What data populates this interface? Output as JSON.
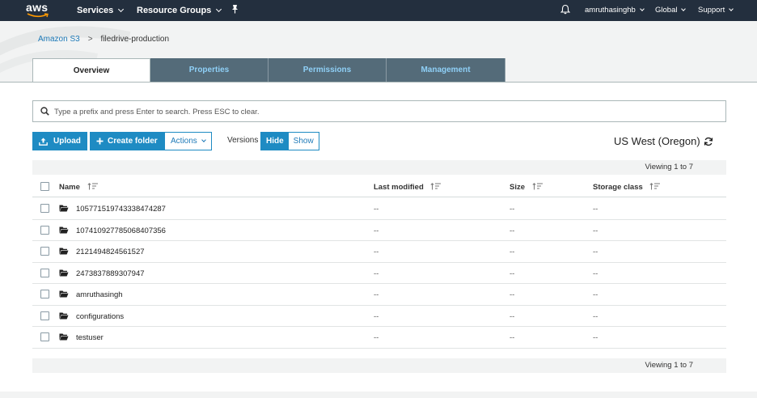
{
  "nav": {
    "logo": "aws",
    "services": "Services",
    "resource_groups": "Resource Groups",
    "pin_icon": "pushpin-icon",
    "bell_icon": "bell-icon",
    "user": "amruthasinghb",
    "region": "Global",
    "support": "Support"
  },
  "breadcrumb": {
    "root": "Amazon S3",
    "separator": ">",
    "current": "filedrive-production"
  },
  "tabs": [
    {
      "label": "Overview",
      "active": true
    },
    {
      "label": "Properties",
      "active": false
    },
    {
      "label": "Permissions",
      "active": false
    },
    {
      "label": "Management",
      "active": false
    }
  ],
  "search": {
    "placeholder": "Type a prefix and press Enter to search. Press ESC to clear.",
    "value": ""
  },
  "toolbar": {
    "upload": "Upload",
    "create_folder": "Create folder",
    "actions": "Actions",
    "versions_label": "Versions",
    "hide": "Hide",
    "show": "Show",
    "region": "US West (Oregon)"
  },
  "table": {
    "viewing": "Viewing 1 to 7",
    "columns": {
      "name": "Name",
      "last_modified": "Last modified",
      "size": "Size",
      "storage_class": "Storage class"
    },
    "rows": [
      {
        "name": "105771519743338474287",
        "last_modified": "--",
        "size": "--",
        "storage_class": "--"
      },
      {
        "name": "107410927785068407356",
        "last_modified": "--",
        "size": "--",
        "storage_class": "--"
      },
      {
        "name": "2121494824561527",
        "last_modified": "--",
        "size": "--",
        "storage_class": "--"
      },
      {
        "name": "2473837889307947",
        "last_modified": "--",
        "size": "--",
        "storage_class": "--"
      },
      {
        "name": "amruthasingh",
        "last_modified": "--",
        "size": "--",
        "storage_class": "--"
      },
      {
        "name": "configurations",
        "last_modified": "--",
        "size": "--",
        "storage_class": "--"
      },
      {
        "name": "testuser",
        "last_modified": "--",
        "size": "--",
        "storage_class": "--"
      }
    ]
  },
  "colors": {
    "nav_bg": "#232f3e",
    "tab_bg": "#546b79",
    "tab_text": "#8fd0f7",
    "primary": "#1e8bc3",
    "link": "#1e7ab8"
  }
}
